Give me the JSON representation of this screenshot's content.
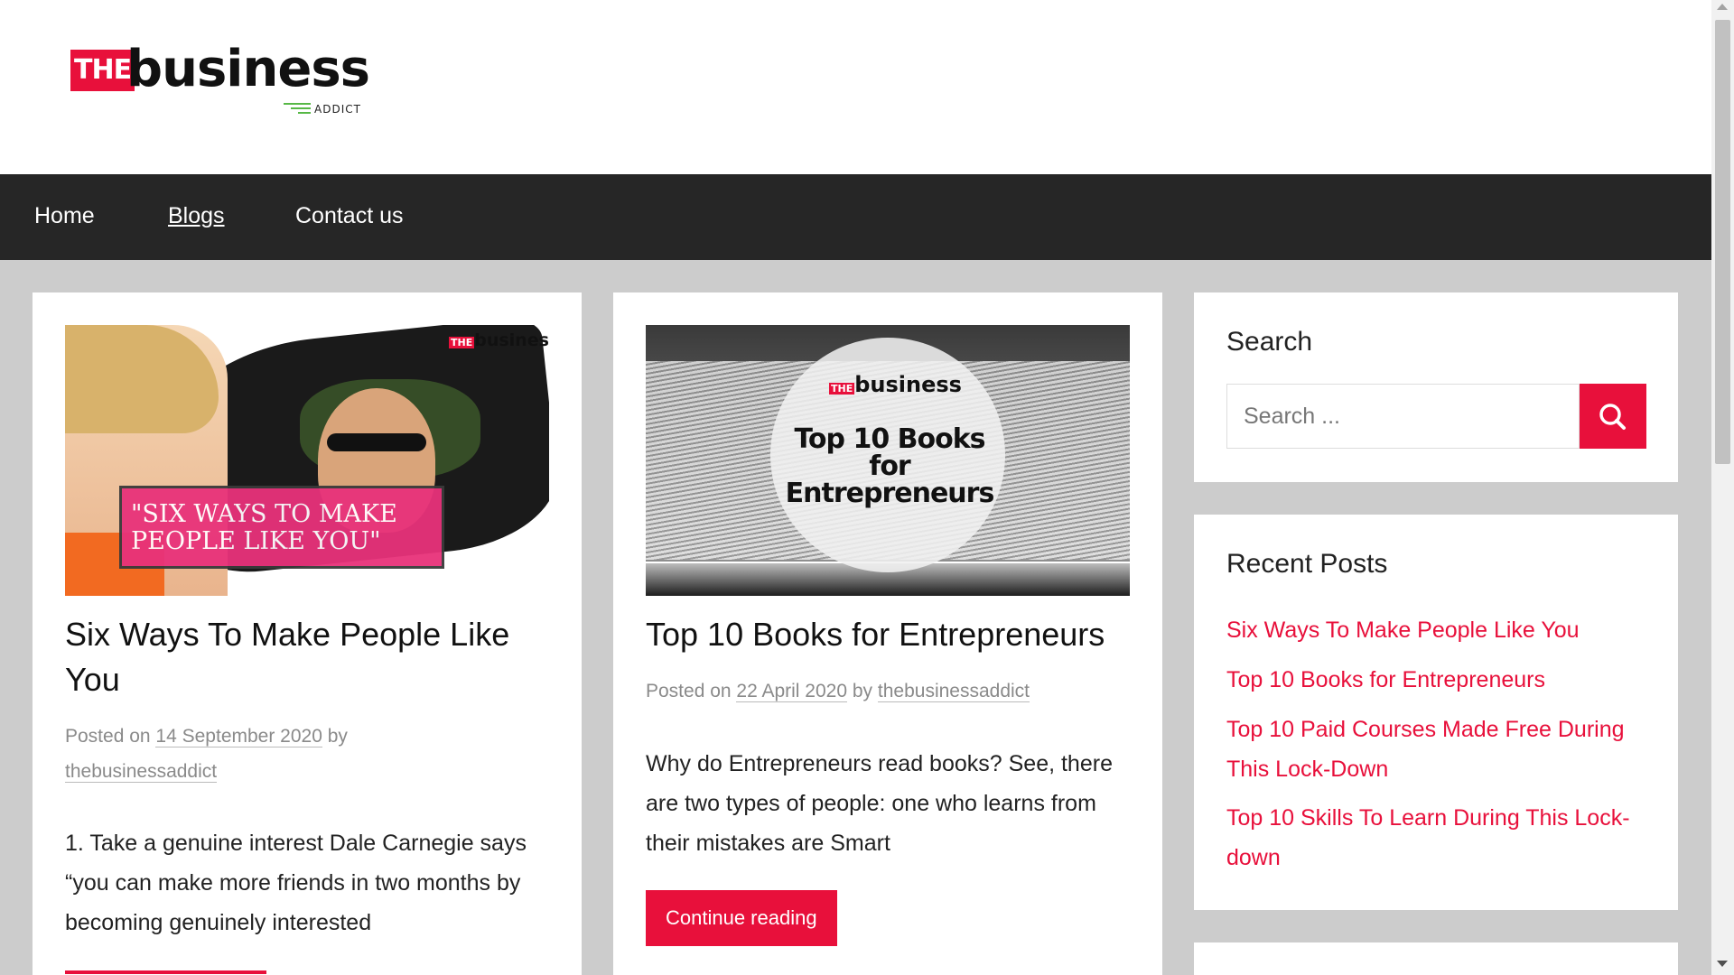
{
  "site": {
    "logo_the": "THE",
    "logo_business": "business",
    "logo_addict": "ADDICT"
  },
  "nav": {
    "items": [
      {
        "label": "Home"
      },
      {
        "label": "Blogs"
      },
      {
        "label": "Contact us"
      }
    ],
    "active": "Blogs"
  },
  "posts": [
    {
      "image_caption": "\"SIX WAYS TO MAKE PEOPLE LIKE YOU\"",
      "image_logo": "business",
      "title": "Six Ways To Make People Like You",
      "meta_prefix": "Posted on",
      "date": "14 September 2020",
      "meta_by": "by",
      "author": "thebusinessaddict",
      "excerpt": "1. Take a genuine interest Dale Carnegie says “you can make more friends in two months by becoming genuinely interested"
    },
    {
      "image_caption": "Top 10 Books for Entrepreneurs",
      "image_logo": "business",
      "title": "Top 10 Books for Entrepreneurs",
      "meta_prefix": "Posted on",
      "date": "22 April 2020",
      "meta_by": "by",
      "author": "thebusinessaddict",
      "excerpt": "Why do Entrepreneurs read books? See, there are two types of people: one who learns from their mistakes are Smart",
      "button": "Continue reading"
    }
  ],
  "sidebar": {
    "search": {
      "title": "Search",
      "placeholder": "Search ..."
    },
    "recent": {
      "title": "Recent Posts",
      "items": [
        "Six Ways To Make People Like You",
        "Top 10 Books for Entrepreneurs",
        "Top 10 Paid Courses Made Free During This Lock-Down",
        "Top 10 Skills To Learn During This Lock-down"
      ]
    }
  },
  "colors": {
    "accent": "#e8103b",
    "nav_bg": "#262626",
    "page_bg": "#cccccc"
  }
}
